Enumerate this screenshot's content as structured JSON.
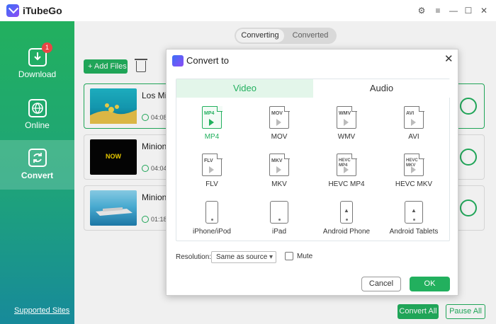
{
  "app": {
    "title": "iTubeGo"
  },
  "window_controls": [
    "gear-icon",
    "menu-icon",
    "minimize-icon",
    "maximize-icon",
    "close-icon"
  ],
  "sidebar": {
    "items": [
      {
        "label": "Download",
        "icon": "download-icon",
        "badge": "1",
        "active": false
      },
      {
        "label": "Online",
        "icon": "globe-icon",
        "active": false
      },
      {
        "label": "Convert",
        "icon": "convert-icon",
        "active": true
      }
    ],
    "supported_sites": "Supported Sites"
  },
  "tabs": {
    "converting": "Converting",
    "converted": "Converted",
    "selected": "Converting"
  },
  "toolbar": {
    "add_files": "+ Add Files"
  },
  "files": [
    {
      "title": "Los Mi",
      "time": "04:08",
      "thumb": "underwater"
    },
    {
      "title": "Minion",
      "time": "04:04",
      "thumb": "now-logo"
    },
    {
      "title": "Minion",
      "time": "01:18",
      "thumb": "ship"
    }
  ],
  "thumb_text": {
    "now": "NOW"
  },
  "bottom": {
    "convert_all": "Convert All",
    "pause_all": "Pause All"
  },
  "dialog": {
    "title": "Convert to",
    "tabs": {
      "video": "Video",
      "audio": "Audio",
      "selected": "Video"
    },
    "formats": [
      {
        "label": "MP4",
        "badge": "MP4",
        "selected": true
      },
      {
        "label": "MOV",
        "badge": "MOV"
      },
      {
        "label": "WMV",
        "badge": "WMV"
      },
      {
        "label": "AVI",
        "badge": "AVI"
      },
      {
        "label": "FLV",
        "badge": "FLV"
      },
      {
        "label": "MKV",
        "badge": "MKV"
      },
      {
        "label": "HEVC MP4",
        "badge": "HEVC MP4"
      },
      {
        "label": "HEVC MKV",
        "badge": "HEVC MKV"
      },
      {
        "label": "iPhone/iPod",
        "device": "apple-phone"
      },
      {
        "label": "iPad",
        "device": "apple-tablet"
      },
      {
        "label": "Android Phone",
        "device": "android-phone"
      },
      {
        "label": "Android Tablets",
        "device": "android-tablet"
      }
    ],
    "resolution_label": "Resolution:",
    "resolution_value": "Same as source",
    "mute_label": "Mute",
    "mute_checked": false,
    "cancel": "Cancel",
    "ok": "OK"
  },
  "colors": {
    "accent": "#22b05e",
    "danger": "#e84545"
  }
}
